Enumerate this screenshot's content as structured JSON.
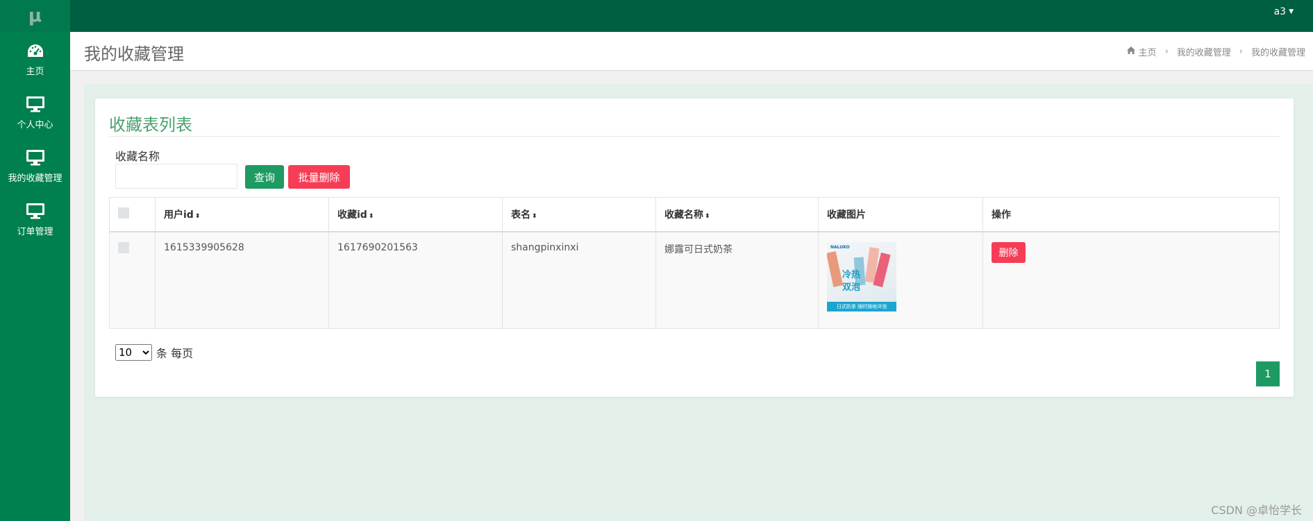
{
  "topbar": {
    "logo": "μ",
    "user": "a3"
  },
  "sidebar": {
    "items": [
      {
        "label": "主页",
        "icon": "dashboard-icon"
      },
      {
        "label": "个人中心",
        "icon": "monitor-icon"
      },
      {
        "label": "我的收藏管理",
        "icon": "monitor-icon"
      },
      {
        "label": "订单管理",
        "icon": "monitor-icon"
      }
    ]
  },
  "header": {
    "title": "我的收藏管理",
    "breadcrumb": [
      "主页",
      "我的收藏管理",
      "我的收藏管理"
    ]
  },
  "card": {
    "title": "收藏表列表",
    "search": {
      "label": "收藏名称",
      "value": "",
      "placeholder": ""
    },
    "buttons": {
      "search": "查询",
      "batch_delete": "批量删除"
    }
  },
  "table": {
    "columns": [
      "用户id",
      "收藏id",
      "表名",
      "收藏名称",
      "收藏图片",
      "操作"
    ],
    "rows": [
      {
        "user_id": "1615339905628",
        "fav_id": "1617690201563",
        "table_name": "shangpinxinxi",
        "name": "娜露可日式奶茶",
        "image_text": {
          "brand": "NALUKO",
          "line1": "冷热",
          "line2": "双泡",
          "banner": "日式奶茶 随时随地冲泡"
        },
        "action": "删除"
      }
    ]
  },
  "pager": {
    "size_value": "10",
    "size_suffix": "条 每页",
    "current_page": "1"
  },
  "watermark": "CSDN @卓怡学长",
  "colors": {
    "topbar": "#005e41",
    "sidebar": "#007f4f",
    "accent": "#1e9a63",
    "danger": "#f63d55",
    "content_bg": "#e3f0ea"
  }
}
